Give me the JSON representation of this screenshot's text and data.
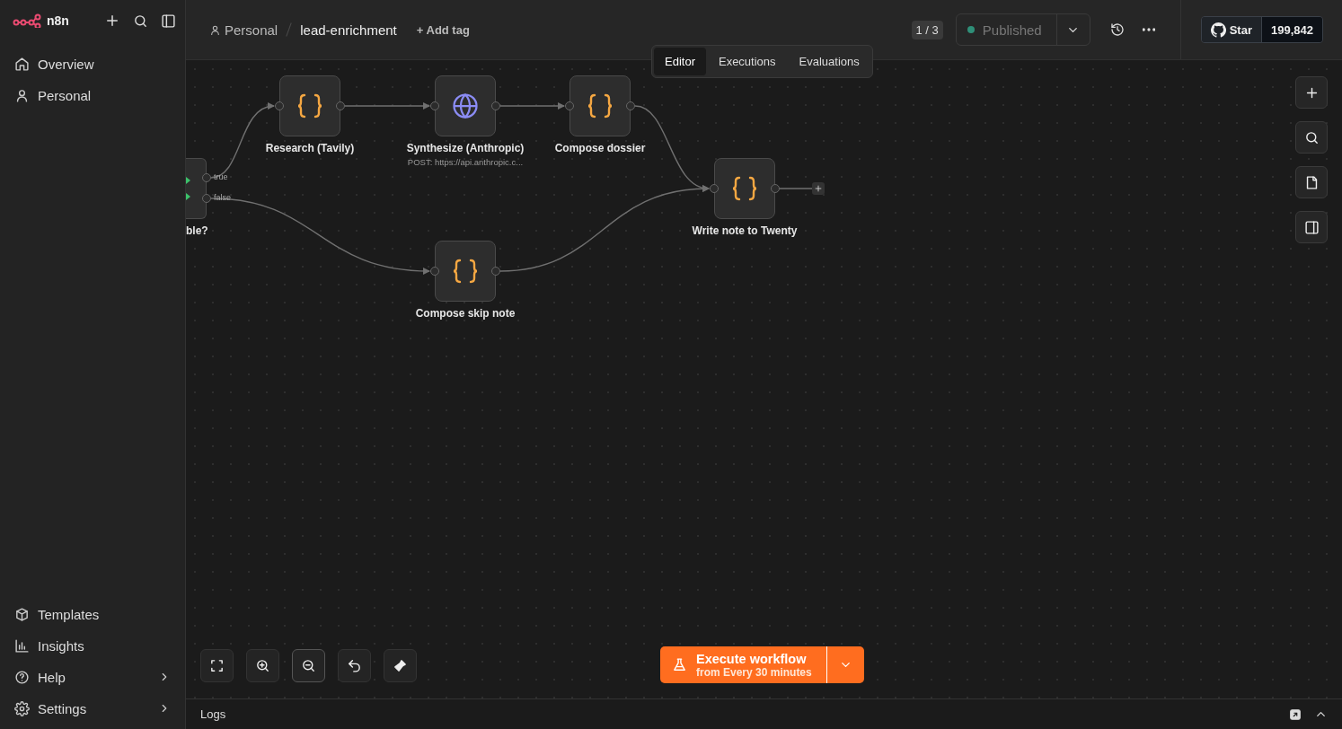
{
  "sidebar": {
    "logo": "n8n",
    "nav_items": [
      {
        "label": "Overview"
      },
      {
        "label": "Personal"
      }
    ],
    "bottom_items": [
      {
        "label": "Templates",
        "expandable": false
      },
      {
        "label": "Insights",
        "expandable": false
      },
      {
        "label": "Help",
        "expandable": true
      },
      {
        "label": "Settings",
        "expandable": true
      }
    ]
  },
  "header": {
    "project": "Personal",
    "workflow_name": "lead-enrichment",
    "add_tag": "+ Add tag",
    "version_counter": "1 / 3",
    "publish": {
      "label": "Published",
      "disabled": true
    },
    "github": {
      "label": "Star",
      "count": "199,842"
    }
  },
  "view_tabs": [
    {
      "label": "Editor",
      "selected": true
    },
    {
      "label": "Executions",
      "selected": false
    },
    {
      "label": "Evaluations",
      "selected": false
    }
  ],
  "nodes": [
    {
      "kind": "if",
      "label": "ble?",
      "outputs": [
        "true",
        "false"
      ]
    },
    {
      "kind": "code",
      "label": "Research (Tavily)"
    },
    {
      "kind": "http",
      "label": "Synthesize (Anthropic)",
      "subtitle": "POST: https://api.anthropic.c..."
    },
    {
      "kind": "code",
      "label": "Compose dossier"
    },
    {
      "kind": "code",
      "label": "Write note to Twenty"
    },
    {
      "kind": "code",
      "label": "Compose skip note"
    }
  ],
  "execute_button": {
    "label": "Execute workflow",
    "trigger": "from Every 30 minutes"
  },
  "logs": {
    "title": "Logs"
  }
}
